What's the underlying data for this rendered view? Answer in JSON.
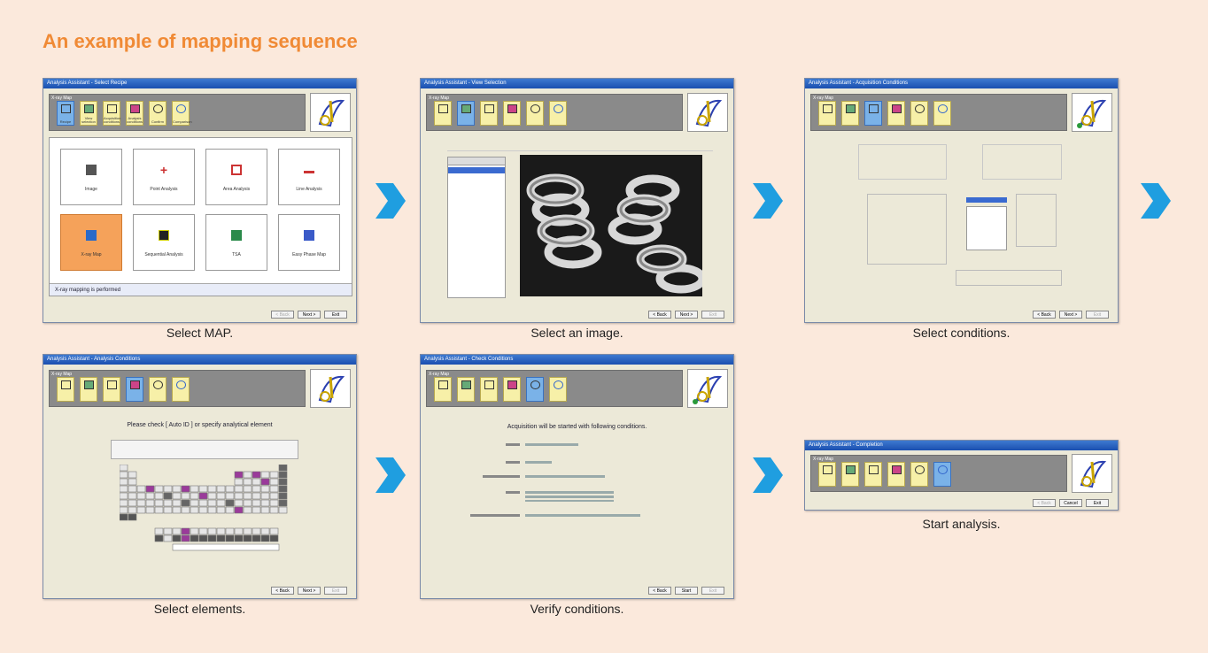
{
  "title": "An example of mapping sequence",
  "window_titles": [
    "Analysis Assistant - Select Recipe",
    "Analysis Assistant - View Selection",
    "Analysis Assistant - Acquisition Conditions",
    "Analysis Assistant - Analysis Conditions",
    "Analysis Assistant - Check Conditions",
    "Analysis Assistant - Completion"
  ],
  "toolbar_group": "X-ray Map",
  "toolbar_buttons": [
    "Recipe",
    "View selection",
    "Acquisition conditions",
    "Analysis conditions",
    "Confirm",
    "Comparison"
  ],
  "steps": [
    {
      "caption": "Select MAP."
    },
    {
      "caption": "Select an image."
    },
    {
      "caption": "Select conditions."
    },
    {
      "caption": "Select elements."
    },
    {
      "caption": "Verify conditions."
    },
    {
      "caption": "Start analysis."
    }
  ],
  "recipe_tiles": [
    "Image",
    "Point Analysis",
    "Area Analysis",
    "Line Analysis",
    "X-ray Map",
    "Sequential Analysis",
    "TSA",
    "Easy Phase Map"
  ],
  "recipe_status": "X-ray mapping is performed",
  "buttons": {
    "back": "< Back",
    "next": "Next >",
    "exit": "Exit",
    "start": "Start",
    "cancel": "Cancel"
  },
  "elements_heading": "Please check [ Auto ID ] or specify analytical element",
  "confirm_heading": "Acquisition will be started with following conditions.",
  "colors": {
    "arrow": "#1f9ee0",
    "title": "#f08a35",
    "background": "#fbe9dc"
  }
}
